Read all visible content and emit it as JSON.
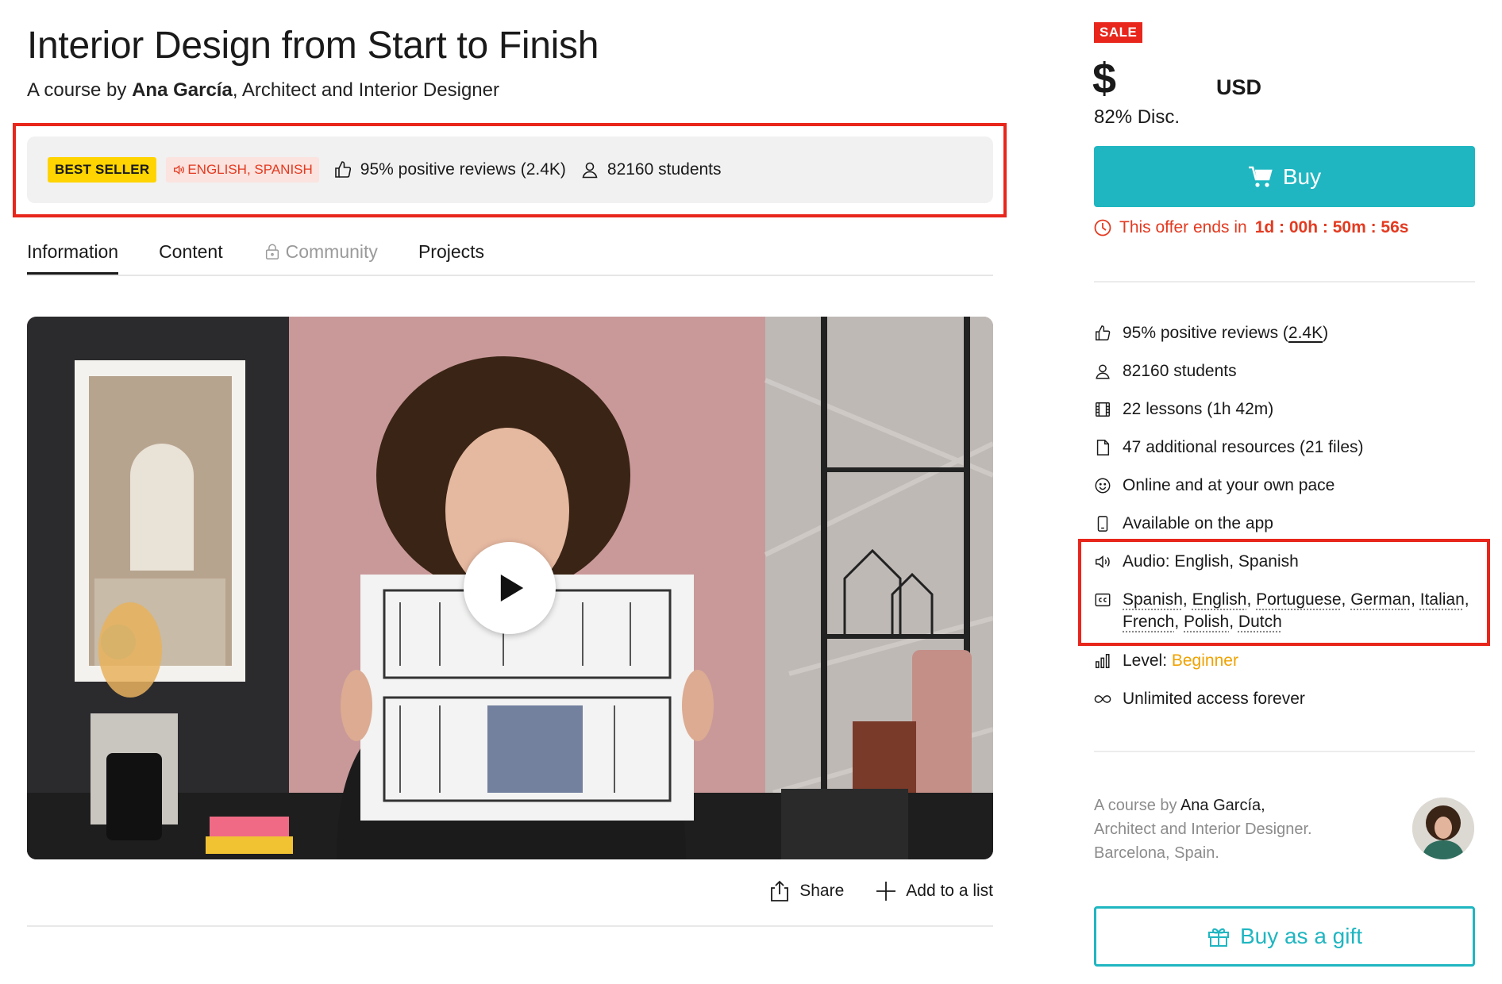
{
  "course": {
    "title": "Interior Design from Start to Finish",
    "by_prefix": "A course by ",
    "author_name": "Ana García",
    "author_role": ", Architect and Interior Designer"
  },
  "meta_bar": {
    "best_seller": "BEST SELLER",
    "languages": "ENGLISH, SPANISH",
    "reviews": "95% positive reviews (2.4K)",
    "students": "82160 students"
  },
  "tabs": [
    {
      "label": "Information",
      "active": true,
      "locked": false
    },
    {
      "label": "Content",
      "active": false,
      "locked": false
    },
    {
      "label": "Community",
      "active": false,
      "locked": true
    },
    {
      "label": "Projects",
      "active": false,
      "locked": false
    }
  ],
  "actions": {
    "share": "Share",
    "add_to_list": "Add to a list"
  },
  "pricing": {
    "sale_badge": "SALE",
    "currency_symbol": "$",
    "currency_code": "USD",
    "discount": "82% Disc.",
    "buy_label": "Buy",
    "offer_prefix": "This offer ends in",
    "offer_countdown": "1d : 00h : 50m : 56s"
  },
  "features": {
    "reviews_text": "95% positive reviews (",
    "reviews_count": "2.4K",
    "reviews_close": ")",
    "students": "82160 students",
    "lessons": "22 lessons (1h 42m)",
    "resources": "47 additional resources (21 files)",
    "pace": "Online and at your own pace",
    "app": "Available on the app",
    "audio": "Audio: English, Spanish",
    "subtitles": [
      "Spanish",
      "English",
      "Portuguese",
      "German",
      "Italian",
      "French",
      "Polish",
      "Dutch"
    ],
    "level_label": "Level: ",
    "level_value": "Beginner",
    "access": "Unlimited access forever"
  },
  "author_card": {
    "prefix": "A course by ",
    "name": "Ana García,",
    "role": "Architect and Interior Designer.",
    "location": "Barcelona, Spain."
  },
  "gift_label": "Buy as a gift",
  "colors": {
    "accent": "#1fb6c1",
    "sale_red": "#e8261b",
    "best_seller_yellow": "#ffd400",
    "level_orange": "#f0a200",
    "highlight_box": "#e8261b"
  }
}
